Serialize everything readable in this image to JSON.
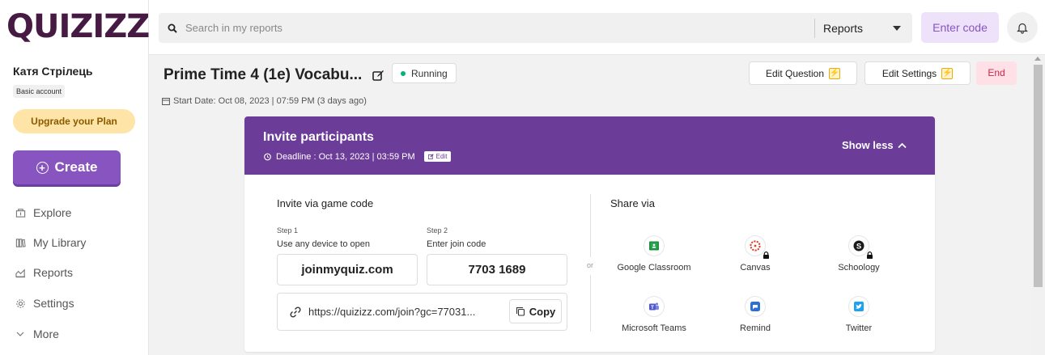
{
  "brand": {
    "logo": "QUIZIZZ"
  },
  "user": {
    "name": "Катя Стрілець",
    "account": "Basic account",
    "upgrade": "Upgrade your Plan"
  },
  "sidebar": {
    "create": "Create",
    "items": [
      {
        "label": "Explore",
        "icon": "compass-icon"
      },
      {
        "label": "My Library",
        "icon": "library-icon"
      },
      {
        "label": "Reports",
        "icon": "reports-icon"
      },
      {
        "label": "Settings",
        "icon": "gear-icon"
      },
      {
        "label": "More",
        "icon": "chevron-down-icon"
      }
    ]
  },
  "topbar": {
    "search_placeholder": "Search in my reports",
    "filter": "Reports",
    "enter_code": "Enter code"
  },
  "report": {
    "title": "Prime Time 4 (1e) Vocabu...",
    "status": "Running",
    "start_date": "Start Date: Oct 08, 2023 | 07:59 PM (3 days ago)",
    "edit_question": "Edit Question",
    "edit_settings": "Edit Settings",
    "end": "End"
  },
  "invite": {
    "title": "Invite participants",
    "deadline": "Deadline : Oct 13, 2023 | 03:59 PM",
    "edit": "Edit",
    "show_less": "Show less",
    "via_code_title": "Invite via game code",
    "step1_label": "Step 1",
    "step1_desc": "Use any device to open",
    "step1_value": "joinmyquiz.com",
    "step2_label": "Step 2",
    "step2_desc": "Enter join code",
    "step2_value": "7703 1689",
    "or": "or",
    "link": "https://quizizz.com/join?gc=77031...",
    "copy": "Copy",
    "share_title": "Share via",
    "share": [
      {
        "label": "Google Classroom",
        "icon": "google-classroom-icon",
        "color": "#1e8e3e",
        "locked": false
      },
      {
        "label": "Canvas",
        "icon": "canvas-icon",
        "color": "#e13f2b",
        "locked": true
      },
      {
        "label": "Schoology",
        "icon": "schoology-icon",
        "color": "#1a1a1a",
        "locked": true
      },
      {
        "label": "Microsoft Teams",
        "icon": "microsoft-teams-icon",
        "color": "#5059c9",
        "locked": false
      },
      {
        "label": "Remind",
        "icon": "remind-icon",
        "color": "#2c6fd6",
        "locked": false
      },
      {
        "label": "Twitter",
        "icon": "twitter-icon",
        "color": "#1da1f2",
        "locked": false
      }
    ]
  },
  "colors": {
    "brand": "#461a42",
    "accent": "#8854c0",
    "invite_header": "#6c3c99",
    "running": "#00b27b",
    "end": "#d3234b"
  }
}
